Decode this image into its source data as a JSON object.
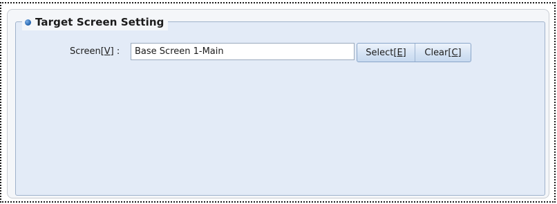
{
  "group": {
    "title": "Target Screen Setting"
  },
  "screen": {
    "label_prefix": "Screen[",
    "label_key": "V",
    "label_suffix": "] :",
    "value": "Base Screen 1-Main"
  },
  "buttons": {
    "select_prefix": "Select[",
    "select_key": "E",
    "select_suffix": "]",
    "clear_prefix": "Clear[",
    "clear_key": "C",
    "clear_suffix": "]"
  },
  "icons": {
    "legend_bullet": "blue-dot-icon"
  },
  "colors": {
    "group_background": "#e3ebf7",
    "group_border": "#9fb2cb",
    "panel_background": "#f4f6f9",
    "bullet": "#2f6fb8"
  }
}
